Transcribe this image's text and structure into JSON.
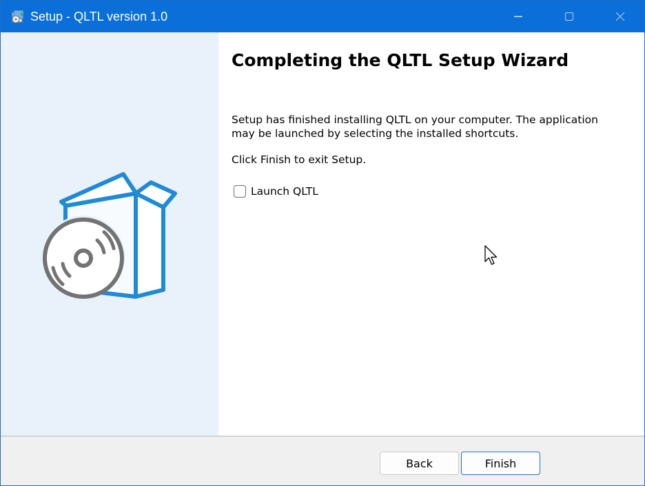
{
  "window": {
    "title": "Setup - QLTL version 1.0",
    "accent_color": "#0a6fd8"
  },
  "icons": {
    "app": "installer-app-icon",
    "minimize": "minimize-icon",
    "maximize": "maximize-icon",
    "close": "close-icon",
    "illustration": "box-with-disc-illustration",
    "cursor": "mouse-pointer-icon"
  },
  "main": {
    "heading": "Completing the QLTL Setup Wizard",
    "body": "Setup has finished installing QLTL on your computer. The application may be launched by selecting the installed shortcuts.",
    "exit_hint": "Click Finish to exit Setup.",
    "launch_checkbox": {
      "label": "Launch QLTL",
      "checked": false
    }
  },
  "footer": {
    "back_label": "Back",
    "finish_label": "Finish"
  }
}
